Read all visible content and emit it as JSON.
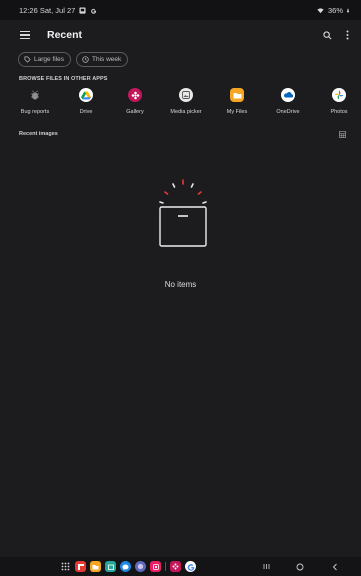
{
  "status_bar": {
    "time_date": "12:26  Sat, Jul 27",
    "battery": "36%"
  },
  "app_bar": {
    "title": "Recent"
  },
  "chips": [
    {
      "label": "Large files",
      "icon": "tag-icon"
    },
    {
      "label": "This week",
      "icon": "clock-icon"
    }
  ],
  "browse_section": {
    "label": "BROWSE FILES IN OTHER APPS",
    "apps": [
      {
        "label": "Bug reports",
        "icon": "bug-icon",
        "color": "#2a2a2e"
      },
      {
        "label": "Drive",
        "icon": "drive-icon",
        "color": "#ffffff"
      },
      {
        "label": "Gallery",
        "icon": "gallery-icon",
        "color": "#c2185b"
      },
      {
        "label": "Media picker",
        "icon": "media-picker-icon",
        "color": "#e8e8e8"
      },
      {
        "label": "My Files",
        "icon": "folder-icon",
        "color": "#f5a623"
      },
      {
        "label": "OneDrive",
        "icon": "onedrive-icon",
        "color": "#ffffff"
      },
      {
        "label": "Photos",
        "icon": "photos-icon",
        "color": "#ffffff"
      }
    ]
  },
  "recent_images": {
    "label": "Recent images",
    "empty_text": "No items"
  },
  "dock": {
    "apps": [
      {
        "name": "app-drawer-icon",
        "color": "#141416"
      },
      {
        "name": "flipboard-icon",
        "color": "#e53935"
      },
      {
        "name": "my-files-icon",
        "color": "#f5a623"
      },
      {
        "name": "calendar-icon",
        "color": "#26a69a"
      },
      {
        "name": "messages-icon",
        "color": "#1e88e5"
      },
      {
        "name": "internet-icon",
        "color": "#5c6bc0"
      },
      {
        "name": "screen-recorder-icon",
        "color": "#e91e63"
      },
      {
        "name": "gallery-dock-icon",
        "color": "#c2185b"
      },
      {
        "name": "google-icon",
        "color": "#ffffff"
      }
    ]
  }
}
